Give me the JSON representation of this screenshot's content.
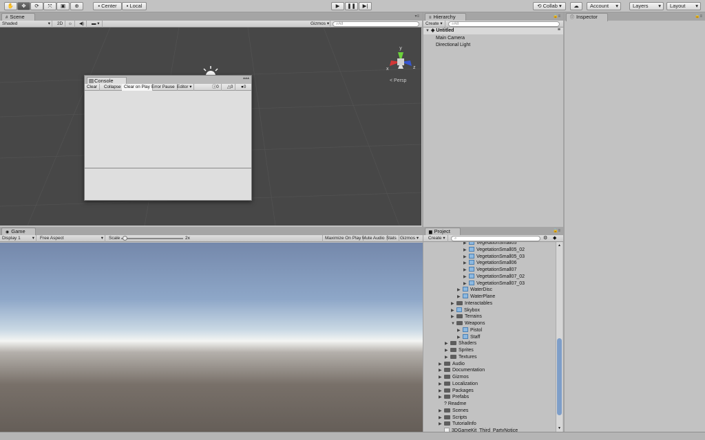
{
  "toolbar": {
    "pivot_center": "Center",
    "pivot_local": "Local",
    "collab": "Collab",
    "account": "Account",
    "layers": "Layers",
    "layout": "Layout"
  },
  "scene": {
    "tab": "Scene",
    "shading": "Shaded",
    "mode_2d": "2D",
    "gizmos": "Gizmos",
    "search_placeholder": "All",
    "persp": "Persp",
    "axis_y": "y",
    "axis_x": "x",
    "axis_z": "z"
  },
  "console": {
    "tab": "Console",
    "buttons": [
      "Clear",
      "Collapse",
      "Clear on Play",
      "Error Pause",
      "Editor"
    ],
    "info_count": "0",
    "warn_count": "0",
    "error_count": "0"
  },
  "game": {
    "tab": "Game",
    "display": "Display 1",
    "aspect": "Free Aspect",
    "scale_label": "Scale",
    "scale_value": "2x",
    "scale_fraction": 0.06,
    "maximize": "Maximize On Play",
    "mute": "Mute Audio",
    "stats": "Stats",
    "gizmos": "Gizmos"
  },
  "hierarchy": {
    "tab": "Hierarchy",
    "create": "Create",
    "search_placeholder": "All",
    "scene_name": "Untitled",
    "items": [
      "Main Camera",
      "Directional Light"
    ]
  },
  "inspector": {
    "tab": "Inspector"
  },
  "project": {
    "tab": "Project",
    "create": "Create",
    "items": [
      {
        "label": "VegetationSmall05",
        "indent": 4,
        "kind": "prefab"
      },
      {
        "label": "VegetationSmall05_02",
        "indent": 4,
        "kind": "prefab"
      },
      {
        "label": "VegetationSmall05_03",
        "indent": 4,
        "kind": "prefab"
      },
      {
        "label": "VegetationSmall06",
        "indent": 4,
        "kind": "prefab"
      },
      {
        "label": "VegetationSmall07",
        "indent": 4,
        "kind": "prefab"
      },
      {
        "label": "VegetationSmall07_02",
        "indent": 4,
        "kind": "prefab"
      },
      {
        "label": "VegetationSmall07_03",
        "indent": 4,
        "kind": "prefab"
      },
      {
        "label": "WaterDisc",
        "indent": 3,
        "kind": "prefab"
      },
      {
        "label": "WaterPlane",
        "indent": 3,
        "kind": "prefab"
      },
      {
        "label": "Interactables",
        "indent": 2,
        "kind": "folder"
      },
      {
        "label": "Skybox",
        "indent": 2,
        "kind": "prefab"
      },
      {
        "label": "Terrains",
        "indent": 2,
        "kind": "folder"
      },
      {
        "label": "Weapons",
        "indent": 2,
        "kind": "folder-open"
      },
      {
        "label": "Pistol",
        "indent": 3,
        "kind": "prefab"
      },
      {
        "label": "Staff",
        "indent": 3,
        "kind": "prefab"
      },
      {
        "label": "Shaders",
        "indent": 1,
        "kind": "folder"
      },
      {
        "label": "Sprites",
        "indent": 1,
        "kind": "folder"
      },
      {
        "label": "Textures",
        "indent": 1,
        "kind": "folder"
      },
      {
        "label": "Audio",
        "indent": 0,
        "kind": "folder"
      },
      {
        "label": "Documentation",
        "indent": 0,
        "kind": "folder"
      },
      {
        "label": "Gizmos",
        "indent": 0,
        "kind": "folder"
      },
      {
        "label": "Localization",
        "indent": 0,
        "kind": "folder"
      },
      {
        "label": "Packages",
        "indent": 0,
        "kind": "folder"
      },
      {
        "label": "Prefabs",
        "indent": 0,
        "kind": "folder"
      },
      {
        "label": "Readme",
        "indent": 0,
        "kind": "readme"
      },
      {
        "label": "Scenes",
        "indent": 0,
        "kind": "folder"
      },
      {
        "label": "Scripts",
        "indent": 0,
        "kind": "folder"
      },
      {
        "label": "TutorialInfo",
        "indent": 0,
        "kind": "folder"
      },
      {
        "label": "3DGameKit_Third_PartyNotice",
        "indent": 0,
        "kind": "file"
      }
    ]
  }
}
